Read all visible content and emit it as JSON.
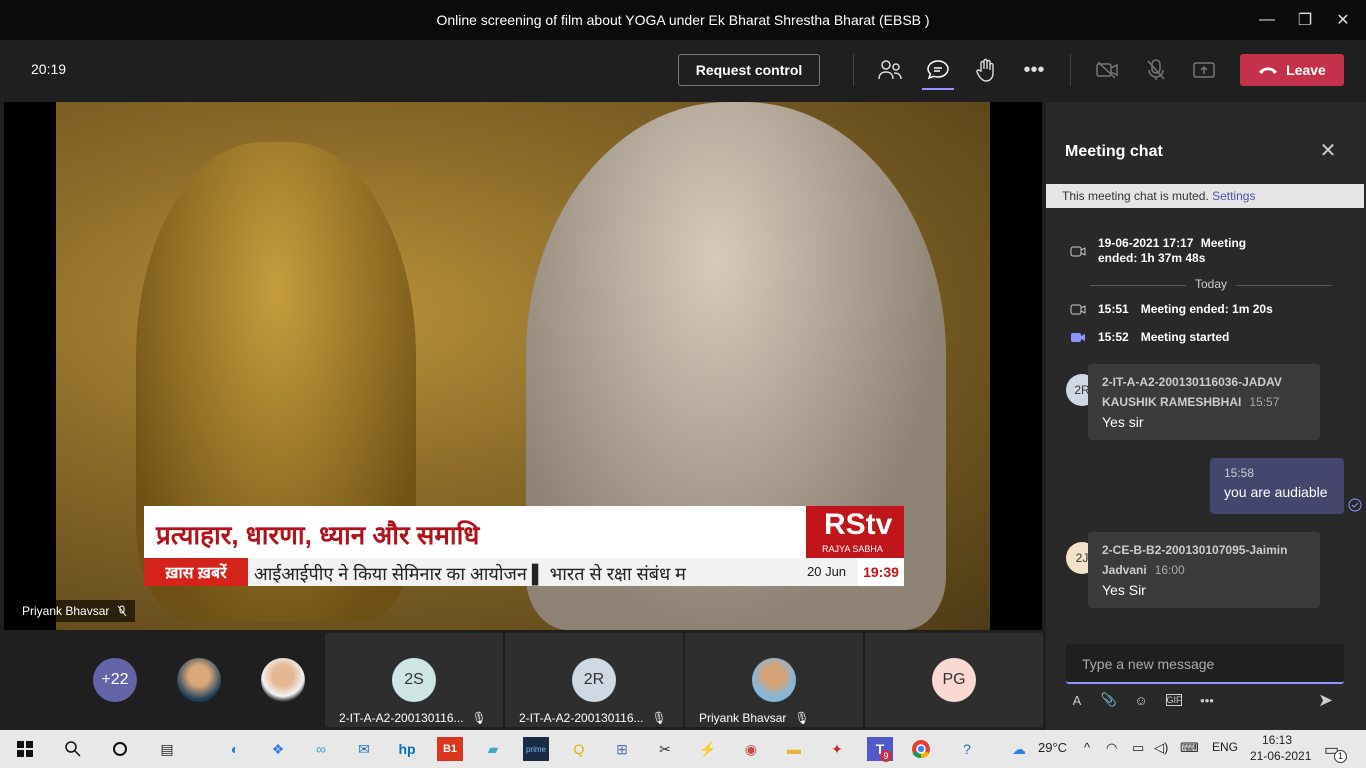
{
  "window": {
    "title": "Online screening of film about YOGA under Ek Bharat Shrestha Bharat (EBSB )"
  },
  "toolbar": {
    "clock": "20:19",
    "request_control": "Request control",
    "leave": "Leave"
  },
  "video": {
    "banner": "प्रत्याहार, धारणा, ध्यान और समाधि",
    "channel": "RStv",
    "channel_sub": "RAJYA SABHA",
    "ticker_tag": "ख़ास ख़बरें",
    "ticker_text": "आईआईपीए ने किया सेमिनार का आयोजन   ▌ भारत से रक्षा संबंध म",
    "ticker_date": "20 Jun",
    "ticker_time": "19:39",
    "presenter": "Priyank Bhavsar"
  },
  "chat": {
    "title": "Meeting chat",
    "muted_text": "This meeting chat is muted.",
    "muted_link": "Settings",
    "event1_time": "19-06-2021 17:17",
    "event1_text": "Meeting ended: 1h 37m 48s",
    "today": "Today",
    "event2_time": "15:51",
    "event2_text": "Meeting ended: 1m 20s",
    "event3_time": "15:52",
    "event3_text": "Meeting started",
    "msg1": {
      "initials": "2R",
      "sender": "2-IT-A-A2-200130116036-JADAV KAUSHIK RAMESHBHAI",
      "time": "15:57",
      "body": "Yes sir"
    },
    "mine": {
      "time": "15:58",
      "body": "you are audiable"
    },
    "msg2": {
      "initials": "2J",
      "sender": "2-CE-B-B2-200130107095-Jaimin Jadvani",
      "time": "16:00",
      "body": "Yes Sir"
    },
    "compose_placeholder": "Type a new message"
  },
  "gallery": {
    "more": "+22",
    "tiles": [
      {
        "initials": "2S",
        "name": "2-IT-A-A2-200130116..."
      },
      {
        "initials": "2R",
        "name": "2-IT-A-A2-200130116..."
      },
      {
        "initials": "",
        "name": "Priyank Bhavsar"
      }
    ],
    "pg": "PG"
  },
  "taskbar": {
    "weather": "29°C",
    "lang": "ENG",
    "time": "16:13",
    "date": "21-06-2021",
    "notif": "1",
    "teams_badge": "9"
  }
}
